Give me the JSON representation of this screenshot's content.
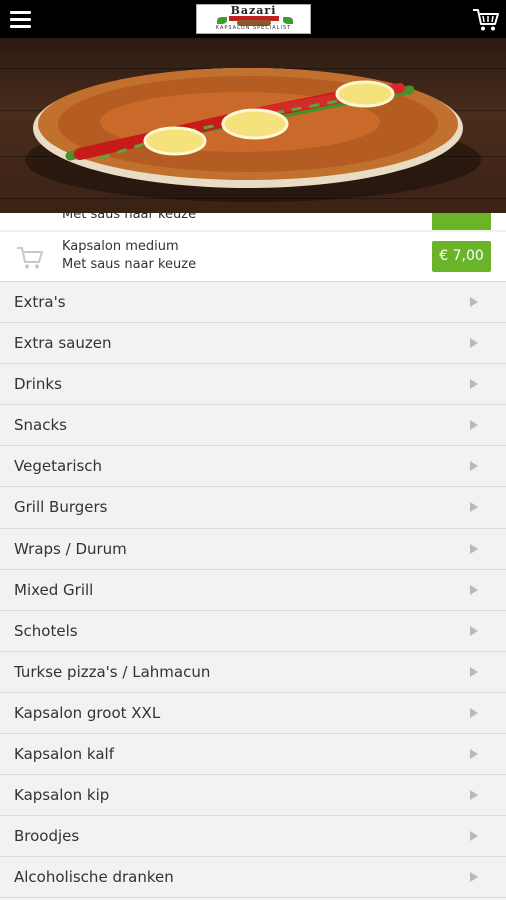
{
  "header": {
    "menu_icon": "hamburger-menu-icon",
    "logo_text": "Bazari",
    "logo_subtitle": "KAPSALON SPECIALIST",
    "cart_icon": "shopping-cart-icon"
  },
  "hero": {
    "image": "lahmacun-pizza-photo"
  },
  "partial_product": {
    "text": "Met saus naar keuze"
  },
  "product": {
    "name": "Kapsalon medium",
    "description": "Met saus naar keuze",
    "price": "€ 7,00",
    "price_color": "#6ab42a",
    "icon": "add-to-cart-icon"
  },
  "categories": [
    {
      "label": "Extra's"
    },
    {
      "label": "Extra sauzen"
    },
    {
      "label": "Drinks"
    },
    {
      "label": "Snacks"
    },
    {
      "label": "Vegetarisch"
    },
    {
      "label": "Grill Burgers"
    },
    {
      "label": "Wraps / Durum"
    },
    {
      "label": "Mixed Grill"
    },
    {
      "label": "Schotels"
    },
    {
      "label": "Turkse pizza's / Lahmacun"
    },
    {
      "label": "Kapsalon groot XXL"
    },
    {
      "label": "Kapsalon kalf"
    },
    {
      "label": "Kapsalon kip"
    },
    {
      "label": "Broodjes"
    },
    {
      "label": "Alcoholische dranken"
    }
  ],
  "category_arrow_icon": "chevron-right-icon"
}
